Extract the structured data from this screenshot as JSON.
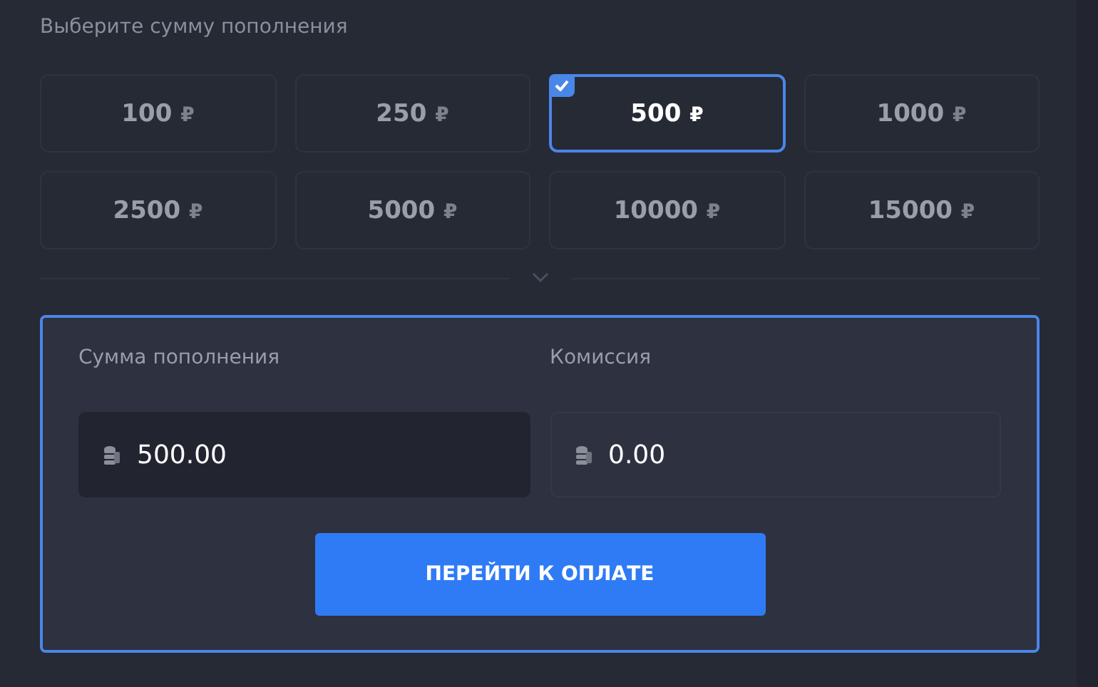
{
  "heading": "Выберите сумму пополнения",
  "amounts": [
    {
      "amount": "100",
      "currency": "₽",
      "selected": false
    },
    {
      "amount": "250",
      "currency": "₽",
      "selected": false
    },
    {
      "amount": "500",
      "currency": "₽",
      "selected": true
    },
    {
      "amount": "1000",
      "currency": "₽",
      "selected": false
    },
    {
      "amount": "2500",
      "currency": "₽",
      "selected": false
    },
    {
      "amount": "5000",
      "currency": "₽",
      "selected": false
    },
    {
      "amount": "10000",
      "currency": "₽",
      "selected": false
    },
    {
      "amount": "15000",
      "currency": "₽",
      "selected": false
    }
  ],
  "form": {
    "fields": [
      {
        "label": "Сумма пополнения",
        "value": "500.00",
        "active": true
      },
      {
        "label": "Комиссия",
        "value": "0.00",
        "active": false
      }
    ],
    "submit": "ПЕРЕЙТИ К ОПЛАТЕ"
  }
}
